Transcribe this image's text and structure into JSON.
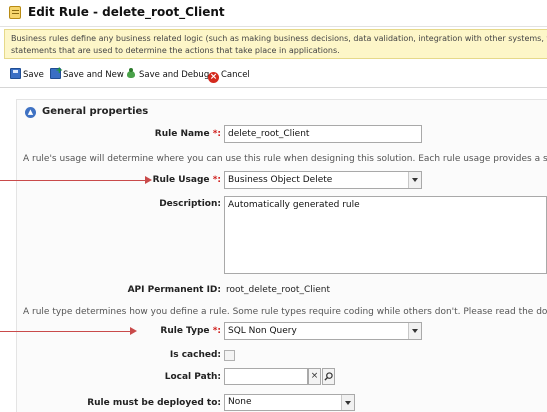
{
  "window": {
    "title": "Edit Rule - delete_root_Client"
  },
  "banner": {
    "line1": "Business rules define any business related logic (such as making business decisions, data validation, integration with other systems, work rou",
    "line2": "statements that are used to determine the actions that take place in applications."
  },
  "toolbar": {
    "save": "Save",
    "save_and_new": "Save and New",
    "save_and_debug": "Save and Debug",
    "cancel": "Cancel"
  },
  "section": {
    "title": "General properties"
  },
  "form": {
    "rule_name": {
      "label": "Rule Name",
      "required": "*:",
      "value": "delete_root_Client"
    },
    "usage_info": "A rule's usage will determine where you can use this rule when designing this solution. Each rule usage provides a set of",
    "rule_usage": {
      "label": "Rule Usage",
      "required": "*:",
      "value": "Business Object Delete"
    },
    "description": {
      "label": "Description:",
      "value": "Automatically generated rule"
    },
    "api_permanent_id": {
      "label": "API Permanent ID:",
      "value": "root_delete_root_Client"
    },
    "type_info": "A rule type determines how you define a rule. Some rule types require coding while others don't. Please read the docum",
    "rule_type": {
      "label": "Rule Type",
      "required": "*:",
      "value": "SQL Non Query"
    },
    "is_cached": {
      "label": "Is cached:"
    },
    "local_path": {
      "label": "Local Path:",
      "value": "",
      "clear": "×"
    },
    "deploy_to": {
      "label": "Rule must be deployed to:",
      "value": "None"
    }
  },
  "colors": {
    "accent": "#3f72c3",
    "required": "#d0201d",
    "banner_bg": "#fdf6c8",
    "arrow": "#c94a4a"
  }
}
